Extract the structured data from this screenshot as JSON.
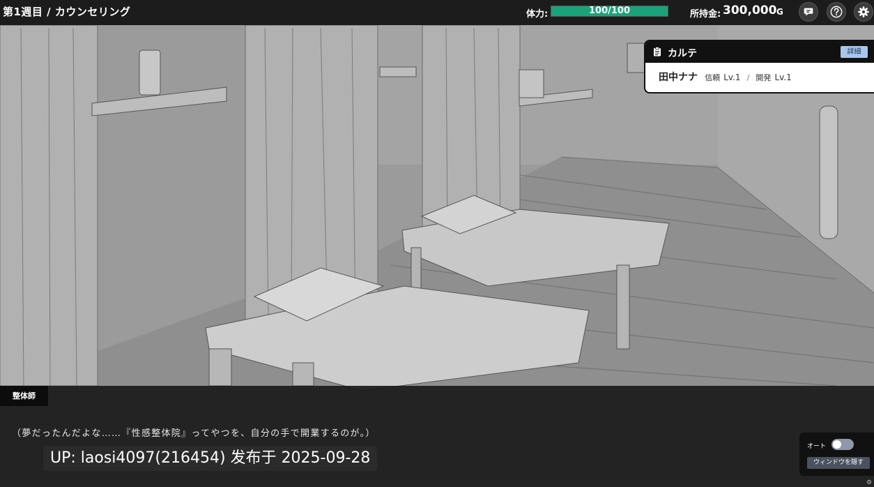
{
  "hud": {
    "stage_title": "第1週目 / カウンセリング",
    "hp_label": "体力:",
    "hp_value": "100/100",
    "hp_fraction": 1.0,
    "money_label": "所持金:",
    "money_value": "300,000",
    "money_unit": "G",
    "buttons": {
      "log": "chat-icon",
      "help": "help-icon",
      "settings": "gear-icon"
    },
    "colors": {
      "hp_fill": "#1aa37a",
      "bar": "#1c1c1c"
    }
  },
  "karte": {
    "title": "カルテ",
    "detail_button": "詳細",
    "patient_name": "田中ナナ",
    "trust_label": "信頼",
    "trust_level": "Lv.1",
    "separator": "/",
    "dev_label": "開発",
    "dev_level": "Lv.1",
    "accent": "#a9c6ea"
  },
  "dialogue": {
    "speaker": "整体師",
    "text": "（夢だったんだよな……『性感整体院』ってやつを、自分の手で開業するのが。）",
    "watermark": "UP: laosi4097(216454) 发布于 2025-09-28"
  },
  "controls": {
    "auto_label": "オート",
    "auto_on": false,
    "hide_window_label": "ウィンドウを隠す",
    "corner_icon": "gear-icon"
  }
}
